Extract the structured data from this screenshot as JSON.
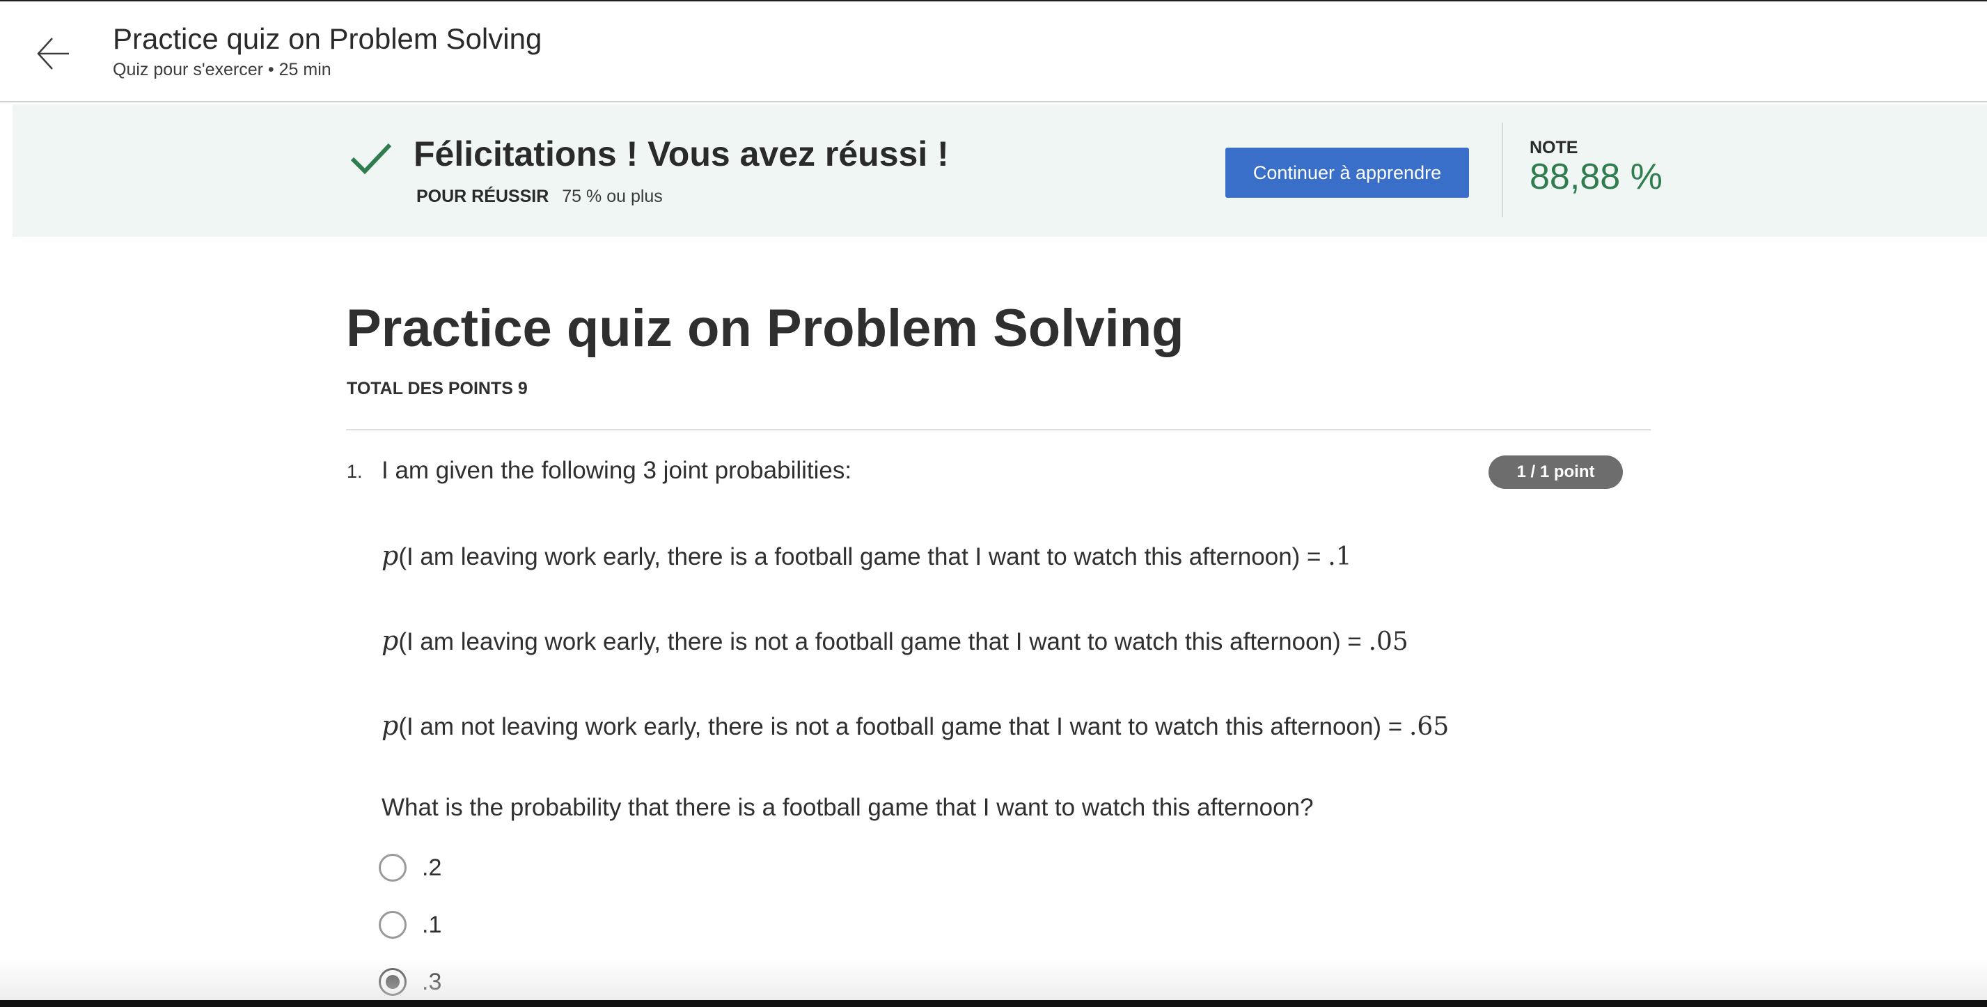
{
  "header": {
    "back_icon": "arrow-left-icon",
    "title": "Practice quiz on Problem Solving",
    "subtitle": "Quiz pour s'exercer • 25  min"
  },
  "banner": {
    "status_icon": "check-icon",
    "title": "Félicitations ! Vous avez réussi !",
    "pass_label": "POUR RÉUSSIR",
    "pass_value": "75 % ou plus",
    "continue_label": "Continuer à apprendre",
    "grade_label": "NOTE",
    "grade_value": "88,88 %",
    "colors": {
      "background": "#f0f6f3",
      "success": "#2f7d4f",
      "button": "#3a6fc9"
    }
  },
  "quiz": {
    "title": "Practice quiz on Problem Solving",
    "total_points": "TOTAL DES POINTS 9"
  },
  "question": {
    "number": "1.",
    "intro": "I am given the following 3 joint probabilities:",
    "points_badge": "1 / 1 point",
    "probabilities": [
      {
        "symbol": "p",
        "text": "(I am leaving work early, there is a football game that I want to watch this afternoon) = ",
        "value": ".1"
      },
      {
        "symbol": "p",
        "text": "(I am leaving work early, there is not a football game that I want to watch this afternoon) = ",
        "value": ".05"
      },
      {
        "symbol": "p",
        "text": "(I am not leaving work early, there is not a football game that I want to watch this afternoon) = ",
        "value": ".65"
      }
    ],
    "prompt": "What is the probability that there is a football game that I want to watch this afternoon?",
    "options": [
      {
        "label": ".2",
        "selected": false
      },
      {
        "label": ".1",
        "selected": false
      },
      {
        "label": ".3",
        "selected": true
      }
    ]
  }
}
